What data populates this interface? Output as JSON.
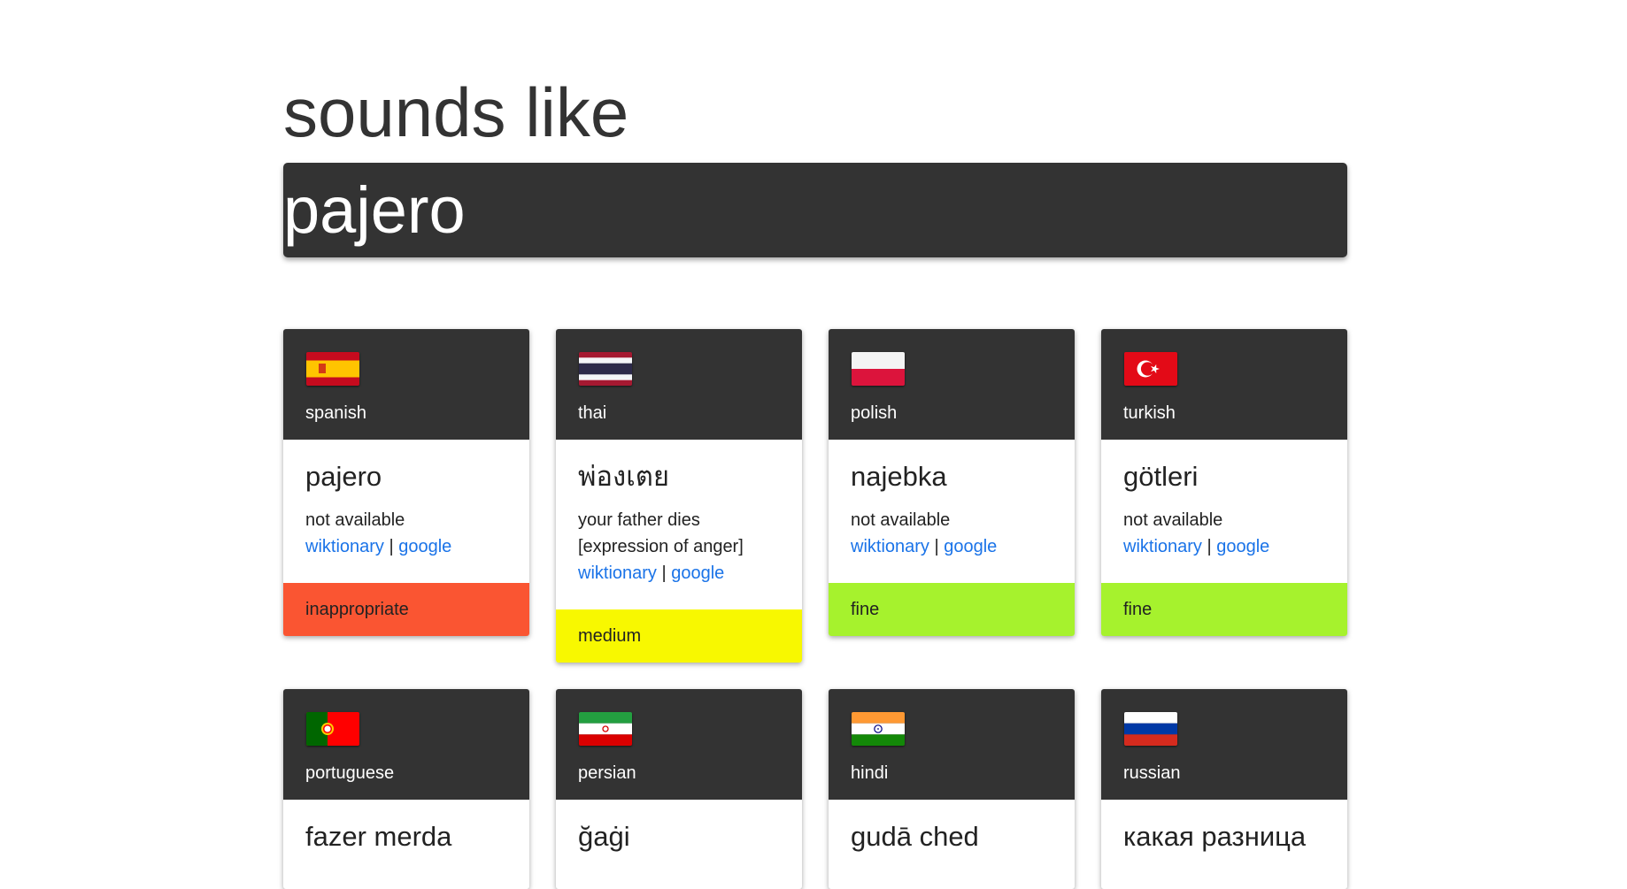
{
  "page": {
    "title": "sounds like"
  },
  "search": {
    "value": "pajero",
    "placeholder": ""
  },
  "links": {
    "wiktionary": "wiktionary",
    "separator": "|",
    "google": "google"
  },
  "cards": [
    {
      "language": "spanish",
      "flag": "spain-flag-icon",
      "word": "pajero",
      "meaning": "not available",
      "rating": "inappropriate",
      "rating_color": "#fa5532"
    },
    {
      "language": "thai",
      "flag": "thailand-flag-icon",
      "word": "พ่องเตย",
      "meaning": "your father dies [expression of anger]",
      "rating": "medium",
      "rating_color": "#f8f800"
    },
    {
      "language": "polish",
      "flag": "poland-flag-icon",
      "word": "najebka",
      "meaning": "not available",
      "rating": "fine",
      "rating_color": "#a6f22d"
    },
    {
      "language": "turkish",
      "flag": "turkey-flag-icon",
      "word": "götleri",
      "meaning": "not available",
      "rating": "fine",
      "rating_color": "#a6f22d"
    },
    {
      "language": "portuguese",
      "flag": "portugal-flag-icon",
      "word": "fazer merda"
    },
    {
      "language": "persian",
      "flag": "iran-flag-icon",
      "word": "ğaġi"
    },
    {
      "language": "hindi",
      "flag": "india-flag-icon",
      "word": "gudā ched"
    },
    {
      "language": "russian",
      "flag": "russia-flag-icon",
      "word": "какая разница"
    }
  ]
}
